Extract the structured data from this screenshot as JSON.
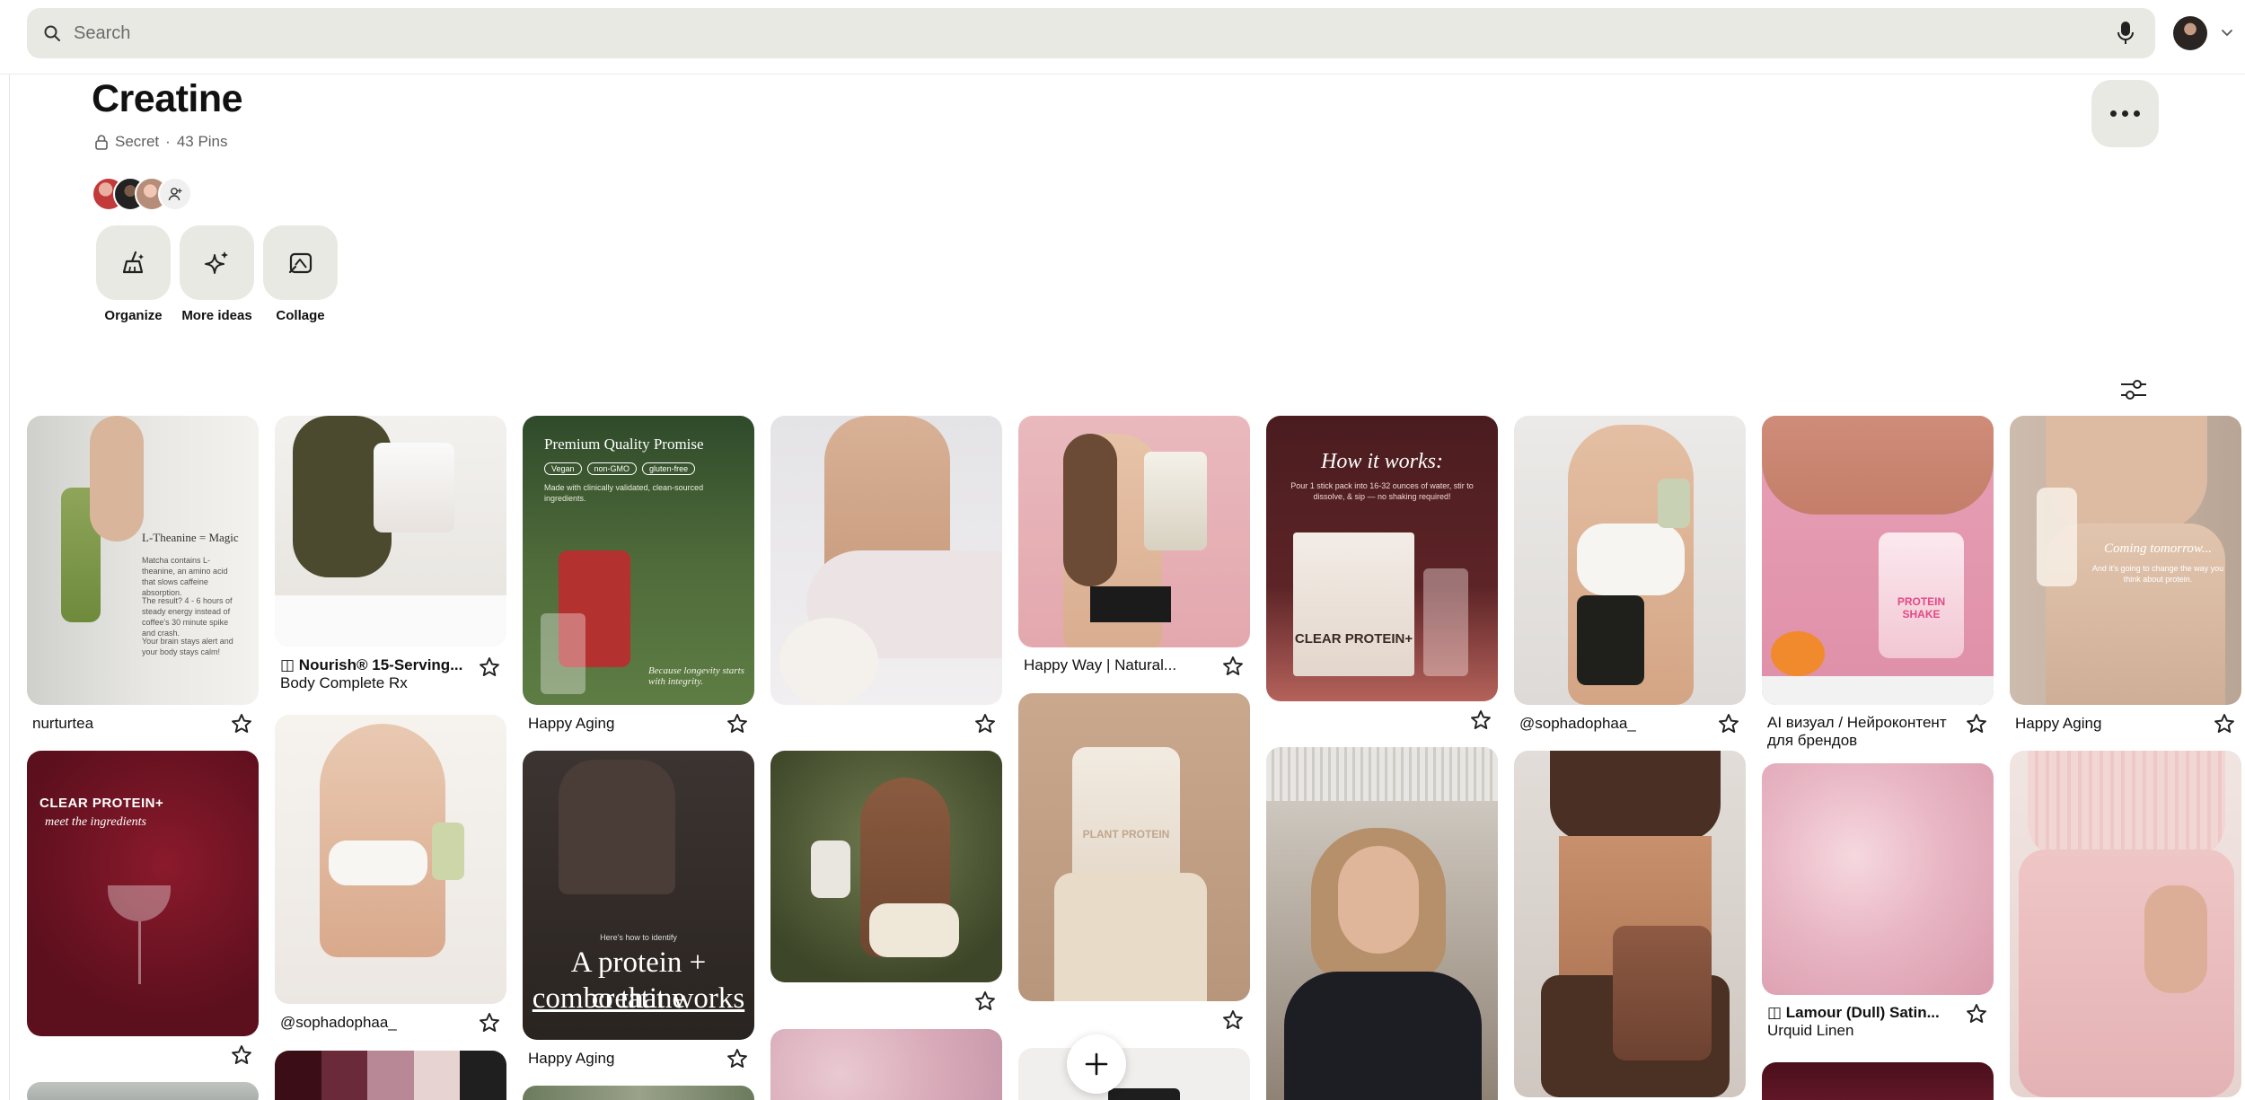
{
  "search": {
    "placeholder": "Search"
  },
  "icons": {
    "search": "search-icon",
    "mic": "microphone-icon",
    "account": "avatar",
    "chevron": "chevron-down-icon",
    "lock": "lock-icon",
    "add_collaborator": "add-person-icon",
    "more": "ellipsis-icon",
    "filter": "sliders-icon",
    "star": "star-outline-icon",
    "plus": "plus-icon",
    "organize": "broom-icon",
    "more_ideas": "sparkle-icon",
    "collage": "collage-icon"
  },
  "board": {
    "title": "Creatine",
    "visibility": "Secret",
    "separator": "·",
    "pin_count": "43 Pins"
  },
  "actions": [
    {
      "label": "Organize"
    },
    {
      "label": "More ideas"
    },
    {
      "label": "Collage"
    }
  ],
  "pins": [
    {
      "caption": "nurturtea",
      "image_lines": [
        "L-Theanine = Magic",
        "Matcha contains L-theanine, an amino acid that slows caffeine absorption.",
        "The result? 4 - 6 hours of steady energy instead of coffee's 30 minute spike and crash.",
        "Your brain stays alert and your body stays calm!"
      ]
    },
    {
      "tag": "Nourish® 15-Serving...",
      "caption2": "Body Complete Rx"
    },
    {
      "caption": "Happy Aging",
      "image_lines": [
        "Premium Quality Promise",
        "Vegan",
        "non-GMO",
        "gluten-free",
        "Made with clinically validated, clean-sourced ingredients.",
        "Because longevity starts with integrity."
      ]
    },
    {
      "caption": ""
    },
    {
      "caption": "Happy Way | Natural..."
    },
    {
      "caption": "",
      "image_lines": [
        "How it works:",
        "Pour 1 stick pack into 16-32 ounces of water, stir to dissolve, & sip — no shaking required!",
        "CLEAR PROTEIN+"
      ]
    },
    {
      "caption": "@sophadophaa_"
    },
    {
      "caption": "AI визуал / Нейроконтент для брендов",
      "image_lines": [
        "PROTEIN SHAKE"
      ]
    },
    {
      "caption": "Happy Aging",
      "image_lines": [
        "Coming tomorrow...",
        "And it's going to change the way you think about protein."
      ]
    },
    {
      "caption": "",
      "image_lines": [
        "CLEAR PROTEIN+",
        "meet the ingredients"
      ]
    },
    {
      "caption": "@sophadophaa_"
    },
    {
      "caption": "Happy Aging",
      "image_lines": [
        "Here's how to identify",
        "A protein + creatine",
        "combo that works"
      ]
    },
    {
      "caption": ""
    },
    {
      "caption": "",
      "image_lines": [
        "PLANT PROTEIN"
      ]
    },
    {
      "caption": ""
    },
    {
      "caption": ""
    },
    {
      "tag": "Lamour (Dull) Satin...",
      "caption2": "Urquid Linen"
    },
    {
      "caption": ""
    }
  ]
}
